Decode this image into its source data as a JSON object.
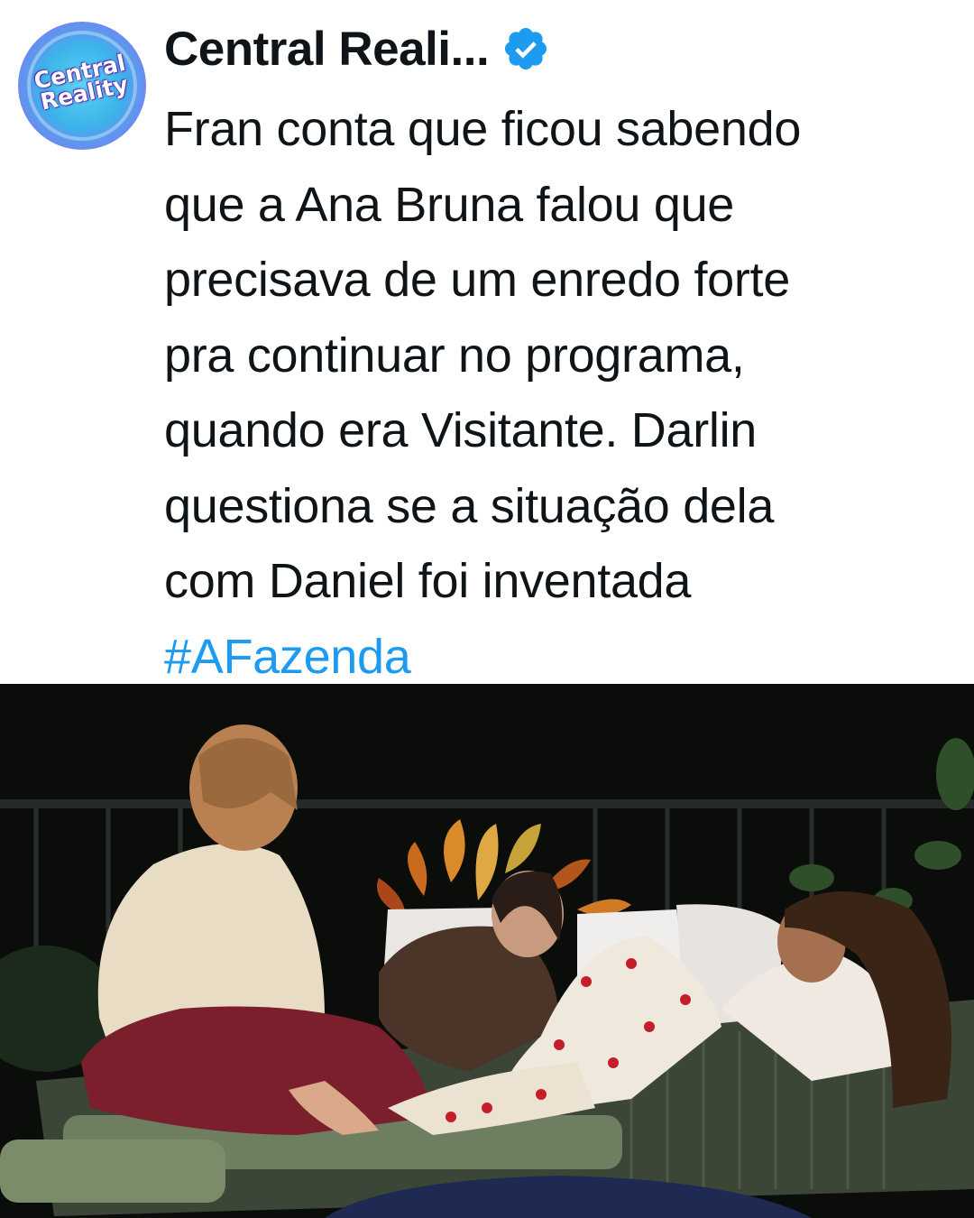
{
  "post": {
    "author": {
      "name": "Central Reali...",
      "avatar_text_line1": "Central",
      "avatar_text_line2": "Reality",
      "verified": true
    },
    "text_lines": [
      "Fran conta que ficou sabendo",
      "que a Ana Bruna falou que",
      "precisava de um enredo forte",
      "pra continuar no programa,",
      "quando era Visitante. Darlin",
      "questiona se a situação dela",
      "com Daniel foi inventada"
    ],
    "hashtag": "#AFazenda"
  },
  "media": {
    "type": "video-frame",
    "description_icon": "photo-icon"
  },
  "colors": {
    "text": "#0f1419",
    "hashtag": "#1d9bf0",
    "verified": "#1d9bf0"
  }
}
